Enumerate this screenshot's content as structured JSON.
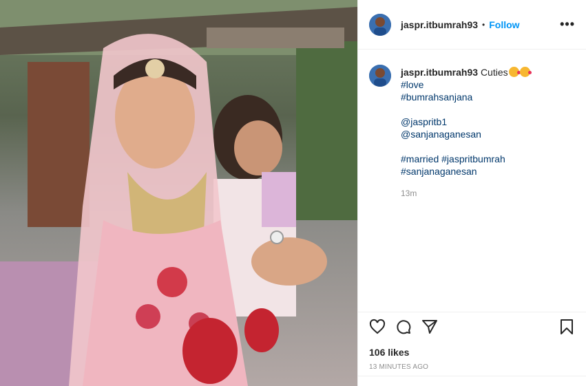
{
  "post": {
    "username": "jaspr.itbumrah93",
    "separator": "•",
    "follow_label": "Follow",
    "more_icon": "more-options-icon",
    "caption": {
      "username": "jaspr.itbumrah93",
      "text": "Cuties",
      "emoji_count": 2,
      "hashtags_1": [
        "#love",
        "#bumrahsanjana"
      ],
      "mentions": [
        "@jaspritb1",
        "@sanjanaganesan"
      ],
      "hashtags_2": [
        "#married #jaspritbumrah",
        "#sanjanaganesan"
      ],
      "time": "13m"
    },
    "likes": "106 likes",
    "time_ago": "13 MINUTES AGO"
  },
  "colors": {
    "accent": "#0095f6",
    "hashtag": "#00376b",
    "muted": "#8e8e8e"
  }
}
